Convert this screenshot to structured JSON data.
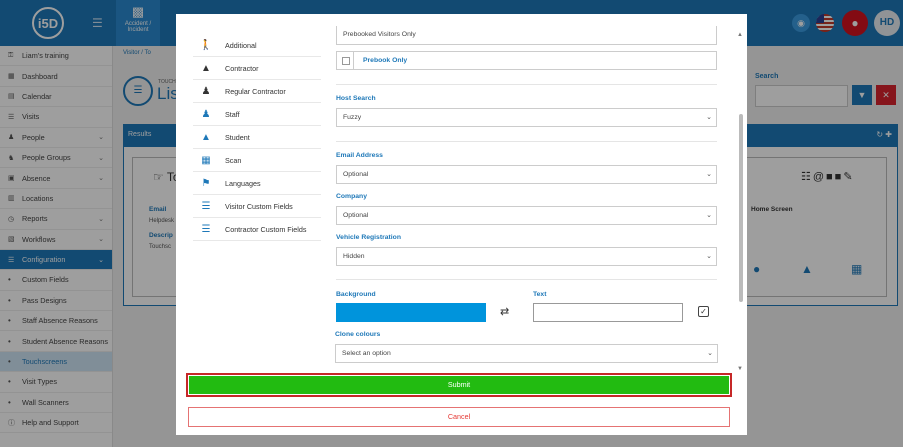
{
  "header": {
    "logo_text": "i5D",
    "accident_label": "Accident / Incident",
    "avatar_initials": "HD"
  },
  "sidebar": {
    "items": [
      {
        "label": "Liam's training",
        "icon": "key-icon",
        "chev": false
      },
      {
        "label": "Dashboard",
        "icon": "dashboard-icon",
        "chev": false
      },
      {
        "label": "Calendar",
        "icon": "calendar-icon",
        "chev": false
      },
      {
        "label": "Visits",
        "icon": "list-icon",
        "chev": false
      },
      {
        "label": "People",
        "icon": "people-icon",
        "chev": true
      },
      {
        "label": "People Groups",
        "icon": "groups-icon",
        "chev": true
      },
      {
        "label": "Absence",
        "icon": "absence-icon",
        "chev": true
      },
      {
        "label": "Locations",
        "icon": "building-icon",
        "chev": false
      },
      {
        "label": "Reports",
        "icon": "clock-icon",
        "chev": true
      },
      {
        "label": "Workflows",
        "icon": "workflow-icon",
        "chev": true
      },
      {
        "label": "Configuration",
        "icon": "config-icon",
        "chev": true,
        "active": true
      },
      {
        "label": "Custom Fields",
        "sub": true
      },
      {
        "label": "Pass Designs",
        "sub": true
      },
      {
        "label": "Staff Absence Reasons",
        "sub": true
      },
      {
        "label": "Student Absence Reasons",
        "sub": true
      },
      {
        "label": "Touchscreens",
        "sub": true,
        "selected": true
      },
      {
        "label": "Visit Types",
        "sub": true
      },
      {
        "label": "Wall Scanners",
        "sub": true
      },
      {
        "label": "Help and Support",
        "icon": "help-icon",
        "chev": false
      }
    ]
  },
  "page": {
    "breadcrumb": "Visitor / To",
    "subtitle": "TOUCH",
    "title": "Lis",
    "search_label": "Search",
    "results_label": "Results",
    "card_title": "To",
    "email_label": "Email",
    "email_value": "Helpdesk",
    "description_label": "Descrip",
    "description_value": "Touchsc",
    "home_screen_label": "Home Screen"
  },
  "modal": {
    "menu": [
      {
        "label": "Additional",
        "icon": "walking-icon"
      },
      {
        "label": "Contractor",
        "icon": "hardhat-icon"
      },
      {
        "label": "Regular Contractor",
        "icon": "user-gear-icon"
      },
      {
        "label": "Staff",
        "icon": "staff-icon"
      },
      {
        "label": "Student",
        "icon": "graduate-icon"
      },
      {
        "label": "Scan",
        "icon": "qr-icon"
      },
      {
        "label": "Languages",
        "icon": "flag-icon"
      },
      {
        "label": "Visitor Custom Fields",
        "icon": "checklist-icon"
      },
      {
        "label": "Contractor Custom Fields",
        "icon": "checklist-icon"
      }
    ],
    "form": {
      "top_select_value": "Prebooked Visitors Only",
      "prebook_only_label": "Prebook Only",
      "host_search_label": "Host Search",
      "host_search_value": "Fuzzy",
      "email_label": "Email Address",
      "email_value": "Optional",
      "company_label": "Company",
      "company_value": "Optional",
      "vehicle_label": "Vehicle Registration",
      "vehicle_value": "Hidden",
      "background_label": "Background",
      "background_color": "#0094dc",
      "text_label": "Text",
      "clone_label": "Clone colours",
      "clone_placeholder": "Select an option"
    },
    "submit_label": "Submit",
    "cancel_label": "Cancel"
  }
}
